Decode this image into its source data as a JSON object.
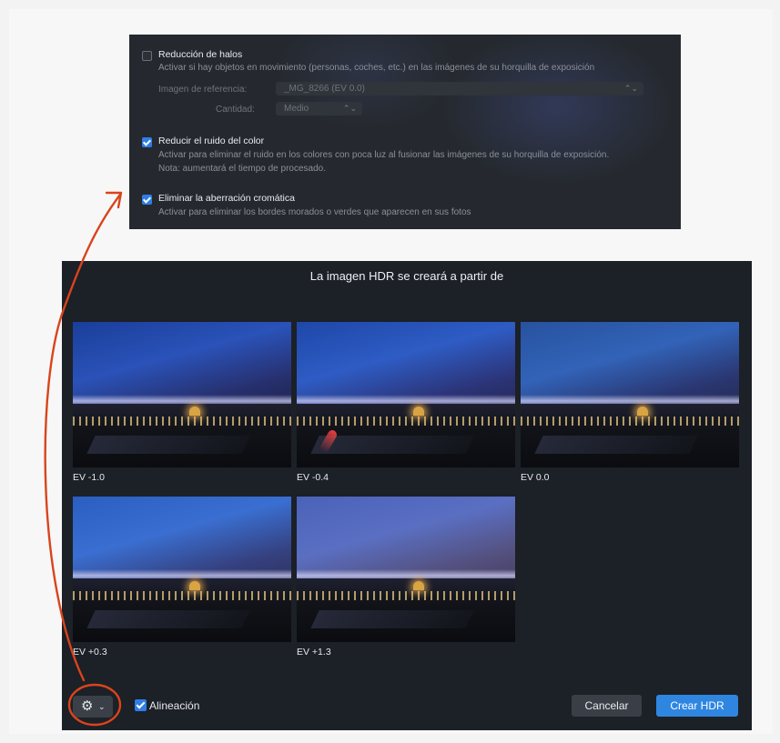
{
  "settings_panel": {
    "halos": {
      "label": "Reducción de halos",
      "checked": false,
      "description": "Activar si hay objetos en movimiento (personas, coches, etc.) en las imágenes de su horquilla de exposición",
      "reference_label": "Imagen de referencia:",
      "reference_value": "_MG_8266 (EV 0.0)",
      "amount_label": "Cantidad:",
      "amount_value": "Medio"
    },
    "color_noise": {
      "label": "Reducir el ruido del color",
      "checked": true,
      "description": "Activar para eliminar el ruido en los colores con poca luz al fusionar las imágenes de su horquilla de exposición.",
      "note": "Nota: aumentará el tiempo de procesado."
    },
    "chromatic": {
      "label": "Eliminar la aberración cromática",
      "checked": true,
      "description": "Activar para eliminar los bordes morados o verdes que aparecen en sus fotos"
    }
  },
  "dialog": {
    "title": "La imagen HDR se creará a partir de",
    "images": [
      {
        "ev_label": "EV -1.0"
      },
      {
        "ev_label": "EV -0.4"
      },
      {
        "ev_label": "EV 0.0"
      },
      {
        "ev_label": "EV +0.3"
      },
      {
        "ev_label": "EV +1.3"
      }
    ],
    "alignment_label": "Alineación",
    "alignment_checked": true,
    "cancel_label": "Cancelar",
    "create_label": "Crear HDR"
  },
  "icons": {
    "gear": "gear-icon",
    "chevron": "chevron-down-icon"
  },
  "colors": {
    "accent_blue": "#2f86e0",
    "annotation_red": "#d9441c",
    "dialog_bg": "#1c2027"
  }
}
